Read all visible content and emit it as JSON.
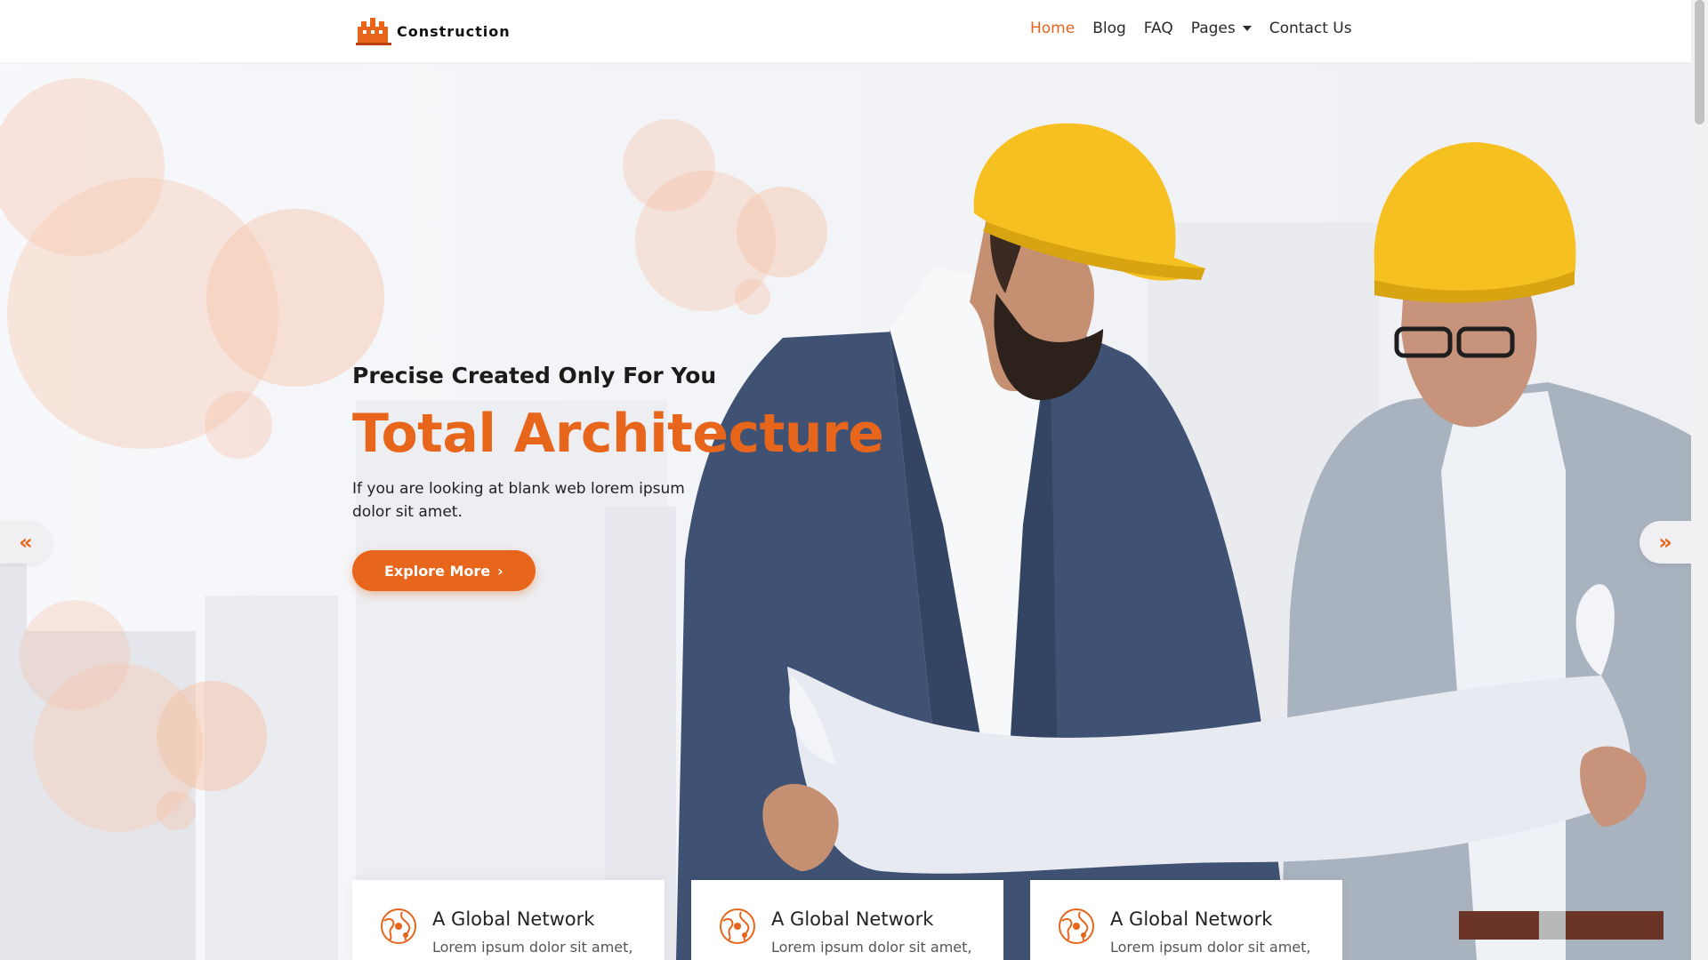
{
  "brand": {
    "name": "Construction"
  },
  "nav": {
    "items": [
      {
        "label": "Home",
        "active": true
      },
      {
        "label": "Blog"
      },
      {
        "label": "FAQ"
      },
      {
        "label": "Pages",
        "dropdown": true
      },
      {
        "label": "Contact Us"
      }
    ]
  },
  "hero": {
    "subtitle": "Precise Created Only For You",
    "title": "Total Architecture",
    "description": "If you are looking at blank web lorem ipsum dolor sit amet.",
    "cta_label": "Explore More",
    "prev_icon": "double-chevron-left-icon",
    "next_icon": "double-chevron-right-icon"
  },
  "features": [
    {
      "title": "A Global Network",
      "text": "Lorem ipsum dolor sit amet,",
      "icon": "globe-network-icon"
    },
    {
      "title": "A Global Network",
      "text": "Lorem ipsum dolor sit amet,",
      "icon": "globe-network-icon"
    },
    {
      "title": "A Global Network",
      "text": "Lorem ipsum dolor sit amet,",
      "icon": "globe-network-icon"
    }
  ],
  "colors": {
    "accent": "#e8651c",
    "helmet": "#f5c020",
    "suit_left": "#3d4e6e",
    "suit_right": "#a7b0bc"
  }
}
